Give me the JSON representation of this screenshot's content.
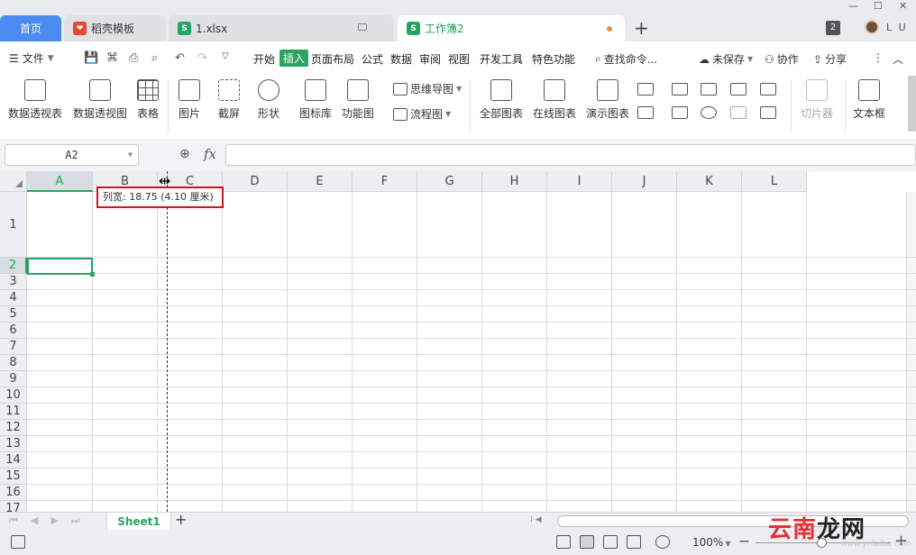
{
  "tabs": [
    {
      "label": "首页"
    },
    {
      "label": "稻壳模板"
    },
    {
      "label": "1.xlsx"
    },
    {
      "label": "工作簿2"
    }
  ],
  "window": {
    "badge": "2",
    "user": "L U"
  },
  "menu": {
    "file": "文件",
    "items": [
      "开始",
      "插入",
      "页面布局",
      "公式",
      "数据",
      "审阅",
      "视图",
      "开发工具",
      "特色功能"
    ],
    "active": "插入",
    "search": "查找命令...",
    "unsaved": "未保存",
    "collab": "协作",
    "share": "分享"
  },
  "ribbon": {
    "pivot_table": "数据透视表",
    "pivot_chart": "数据透视图",
    "table": "表格",
    "picture": "图片",
    "screenshot": "截屏",
    "shapes": "形状",
    "icon_lib": "图标库",
    "func_chart": "功能图",
    "mindmap": "思维导图",
    "flowchart": "流程图",
    "all_charts": "全部图表",
    "online_chart": "在线图表",
    "demo_chart": "演示图表",
    "slicer": "切片器",
    "textbox": "文本框"
  },
  "formula_bar": {
    "name_box": "A2",
    "fx": "fx",
    "value": ""
  },
  "grid": {
    "columns": [
      "A",
      "B",
      "C",
      "D",
      "E",
      "F",
      "G",
      "H",
      "I",
      "J",
      "K",
      "L"
    ],
    "rows": [
      "1",
      "2",
      "3",
      "4",
      "5",
      "6",
      "7",
      "8",
      "9",
      "10",
      "11",
      "12",
      "13",
      "14",
      "15",
      "16",
      "17"
    ],
    "selected_cell": "A2",
    "tooltip": "列宽: 18.75 (4.10 厘米)"
  },
  "sheets": {
    "active": "Sheet1"
  },
  "status": {
    "zoom": "100%"
  },
  "watermark": {
    "text_part1": "云南",
    "text_part2": "龙网",
    "url": "www.ynlaiba.com"
  },
  "colors": {
    "accent": "#25a564",
    "home_tab": "#4a8cf0",
    "tooltip_border": "#d2141c"
  }
}
